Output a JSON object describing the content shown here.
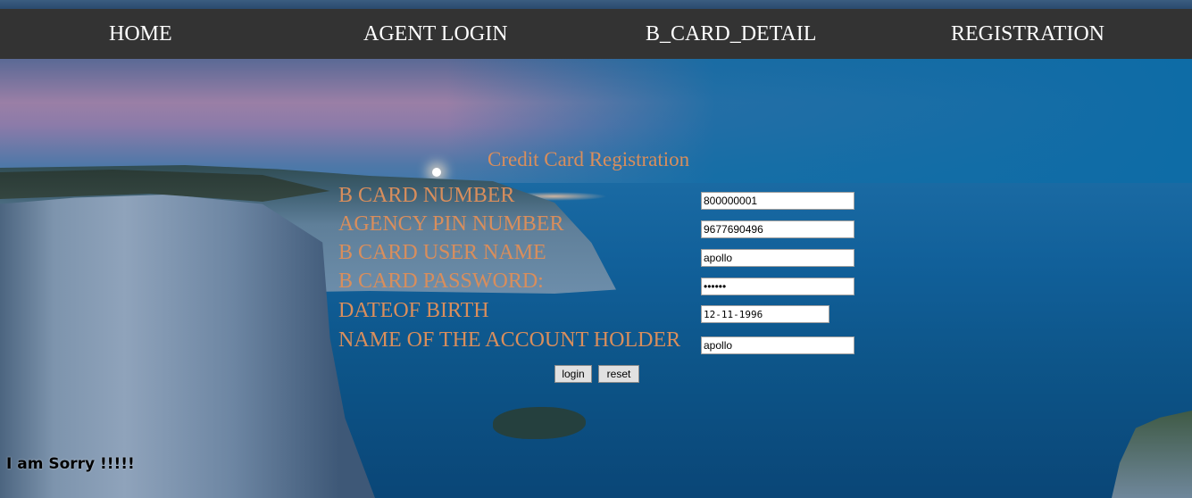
{
  "nav": {
    "home": "HOME",
    "agent_login": "AGENT LOGIN",
    "b_card_detail": "B_CARD_DETAIL",
    "registration": "REGISTRATION"
  },
  "form": {
    "title": "Credit Card Registration",
    "fields": [
      {
        "label": "B CARD NUMBER",
        "value": "800000001"
      },
      {
        "label": "AGENCY PIN NUMBER",
        "value": "9677690496"
      },
      {
        "label": "B CARD USER NAME",
        "value": "apollo"
      },
      {
        "label": "B CARD PASSWORD:",
        "value": "••••••"
      },
      {
        "label": "DATEOF BIRTH",
        "value": "12-11-1996"
      },
      {
        "label": "NAME OF THE ACCOUNT HOLDER",
        "value": "apollo"
      }
    ],
    "login_label": "login",
    "reset_label": "reset"
  },
  "message": "I am Sorry !!!!!",
  "colors": {
    "nav_bg": "#333333",
    "label": "#d98e5c"
  }
}
